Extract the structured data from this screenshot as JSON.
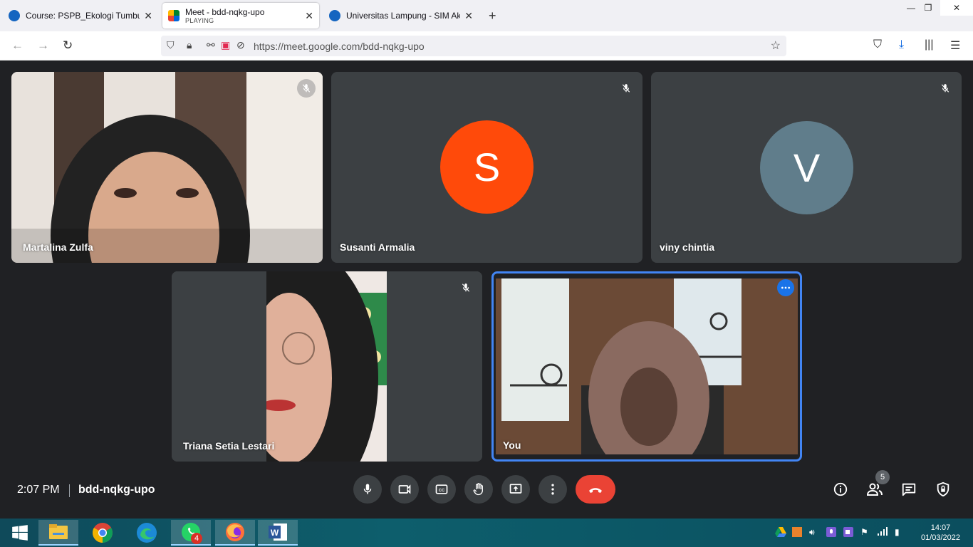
{
  "browser": {
    "tabs": [
      {
        "title": "Course: PSPB_Ekologi Tumbuha",
        "active": false
      },
      {
        "title": "Meet - bdd-nqkg-upo",
        "subtitle": "PLAYING",
        "active": true
      },
      {
        "title": "Universitas Lampung - SIM Aka",
        "active": false
      }
    ],
    "new_tab": "+",
    "url": "https://meet.google.com/bdd-nqkg-upo"
  },
  "meet": {
    "participants": [
      {
        "name": "Martalina Zulfa",
        "type": "video",
        "muted": true
      },
      {
        "name": "Susanti Armalia",
        "type": "avatar",
        "initial": "S",
        "color": "#ff4a0a",
        "muted": true
      },
      {
        "name": "viny chintia",
        "type": "avatar",
        "initial": "V",
        "color": "#607d8b",
        "muted": true
      },
      {
        "name": "Triana Setia Lestari",
        "type": "video",
        "muted": true
      },
      {
        "name": "You",
        "type": "video",
        "self": true,
        "highlight_color": "#4285f4"
      }
    ],
    "bottom_bar": {
      "time": "2:07 PM",
      "meeting_code": "bdd-nqkg-upo",
      "people_count": "5",
      "end_call_color": "#ea4335"
    }
  },
  "taskbar": {
    "whatsapp_badge": "4",
    "time": "14:07",
    "date": "01/03/2022"
  }
}
